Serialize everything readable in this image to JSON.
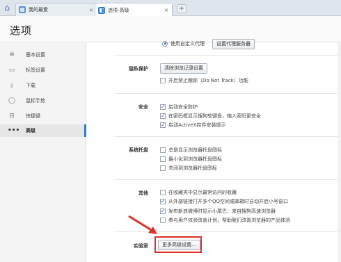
{
  "tabs": [
    {
      "label": "我的最爱",
      "icon": "grid-icon",
      "active": false
    },
    {
      "label": "选项-高级",
      "icon": "settings-page-icon",
      "active": true
    }
  ],
  "header": {
    "title": "选项"
  },
  "sidebar": {
    "items": [
      {
        "label": "基本设置",
        "icon": "gear-icon"
      },
      {
        "label": "标签设置",
        "icon": "tab-icon"
      },
      {
        "label": "下载",
        "icon": "download-icon"
      },
      {
        "label": "鼠标手势",
        "icon": "mouse-icon"
      },
      {
        "label": "快捷键",
        "icon": "keyboard-icon"
      },
      {
        "label": "高级",
        "icon": "more-icon",
        "selected": true
      }
    ]
  },
  "proxy": {
    "radio_label": "使用自定义代理",
    "button": "设置代理服务器"
  },
  "privacy": {
    "label": "隐私保护",
    "button": "清除浏览记录设置",
    "options": [
      {
        "text": "开启禁止跟踪（Do Not Track）功能",
        "checked": false
      }
    ]
  },
  "security": {
    "label": "安全",
    "options": [
      {
        "text": "启动安全防护",
        "checked": true
      },
      {
        "text": "在密码框显示搜狗软键盘，输入密码更安全",
        "checked": true
      },
      {
        "text": "启动ActiveX控件安装提示",
        "checked": true
      }
    ]
  },
  "tray": {
    "label": "系统托盘",
    "options": [
      {
        "text": "总是显示浏览器托盘图标",
        "checked": false
      },
      {
        "text": "最小化到浏览器托盘图标",
        "checked": false
      },
      {
        "text": "关闭到浏览器托盘图标",
        "checked": false
      }
    ]
  },
  "other": {
    "label": "其他",
    "options": [
      {
        "text": "在收藏夹中显示最常访问的收藏",
        "checked": false
      },
      {
        "text": "从外部链接打开多个QQ空间或邮箱时自动开启小号窗口",
        "checked": true
      },
      {
        "text": "发布新浪微博时显示小尾巴：来自搜狗高速浏览器",
        "checked": true
      },
      {
        "text": "参与用户体验改善计划，帮助我们改善浏览器的产品体验",
        "checked": false
      }
    ]
  },
  "lab": {
    "label": "实验室",
    "button": "更多高级设置..."
  },
  "colors": {
    "accent": "#2f7bd6",
    "highlight": "#e0302a"
  }
}
